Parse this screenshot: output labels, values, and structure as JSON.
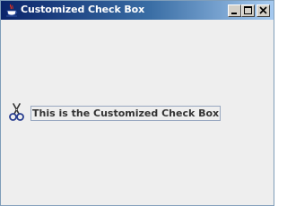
{
  "window": {
    "title": "Customized Check Box",
    "icon": "java-cup-icon",
    "controls": {
      "minimize": "minimize-icon",
      "maximize": "maximize-icon",
      "close": "close-icon"
    }
  },
  "checkbox": {
    "label": "This is the Customized Check Box",
    "icon": "scissors-icon"
  }
}
